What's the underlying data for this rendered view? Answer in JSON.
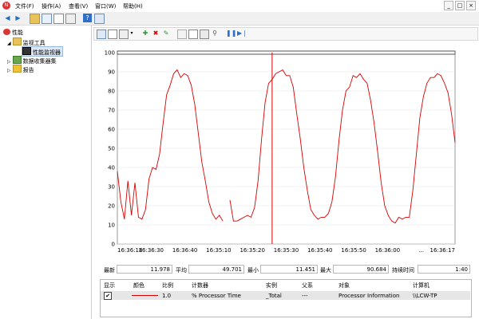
{
  "app": {
    "icon": "perf-app-icon"
  },
  "menu": [
    "文件(F)",
    "操作(A)",
    "查看(V)",
    "窗口(W)",
    "帮助(H)"
  ],
  "window_controls": [
    "_",
    "□",
    "×"
  ],
  "tree": {
    "root": "性能",
    "monitoring_tools": "监视工具",
    "performance_monitor": "性能监视器",
    "data_collector_sets": "数据收集器集",
    "reports": "报告"
  },
  "stats": {
    "last_label": "最新",
    "last_value": "11.978",
    "avg_label": "平均",
    "avg_value": "49.701",
    "min_label": "最小",
    "min_value": "11.451",
    "max_label": "最大",
    "max_value": "90.684",
    "dur_label": "持续时间",
    "dur_value": "1:40"
  },
  "table": {
    "headers": [
      "显示",
      "颜色",
      "比例",
      "计数器",
      "实例",
      "父系",
      "对象",
      "计算机"
    ],
    "row": {
      "show": "✔",
      "scale": "1.0",
      "counter": "% Processor Time",
      "instance": "_Total",
      "parent": "---",
      "object": "Processor Information",
      "computer": "\\\\LCW-TP"
    }
  },
  "colors": {
    "accent": "#d80000",
    "chart_bg": "#ffffff",
    "selected_row": "#e6e6e6"
  },
  "chart_data": {
    "type": "line",
    "x_tick_labels": [
      "16:36:18",
      "16:36:30",
      "16:36:40",
      "16:35:10",
      "16:35:20",
      "16:35:30",
      "16:35:40",
      "16:35:50",
      "16:36:00",
      "...",
      "16:36:17"
    ],
    "ylim": [
      0,
      100
    ],
    "y_ticks": [
      0,
      10,
      20,
      30,
      40,
      50,
      60,
      70,
      80,
      90,
      100
    ],
    "grid": "horizontal",
    "cursor_index": 44,
    "samples": [
      38,
      22,
      13,
      33,
      15,
      32,
      14,
      13,
      18,
      34,
      40,
      39,
      47,
      63,
      78,
      83,
      89,
      91,
      87,
      89,
      88,
      83,
      73,
      58,
      43,
      33,
      22,
      16,
      13,
      15,
      12,
      null,
      23,
      12,
      12,
      13,
      14,
      15,
      14,
      19,
      33,
      55,
      74,
      84,
      86,
      89,
      90,
      91,
      88,
      88,
      82,
      68,
      55,
      40,
      28,
      18,
      15,
      13,
      14,
      14,
      16,
      22,
      35,
      54,
      70,
      80,
      82,
      88,
      87,
      89,
      86,
      84,
      75,
      63,
      48,
      32,
      20,
      15,
      12,
      11,
      14,
      13,
      14,
      14,
      28,
      47,
      66,
      77,
      84,
      87,
      87,
      89,
      88,
      84,
      79,
      68,
      53
    ]
  }
}
